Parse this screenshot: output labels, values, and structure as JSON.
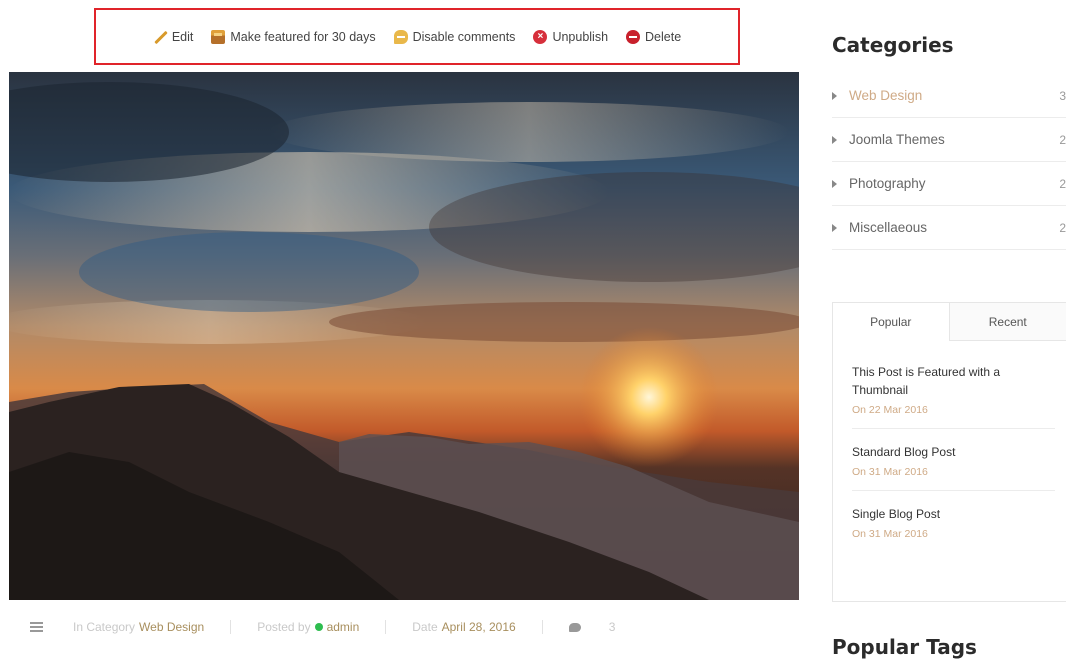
{
  "toolbar": {
    "edit": "Edit",
    "featured": "Make featured for 30 days",
    "disable_comments": "Disable comments",
    "unpublish": "Unpublish",
    "delete": "Delete"
  },
  "meta": {
    "category_prefix": "In Category",
    "category": "Web Design",
    "posted_by_prefix": "Posted by",
    "author": "admin",
    "date_prefix": "Date",
    "date": "April 28, 2016",
    "comments_count": "3"
  },
  "sidebar": {
    "categories_heading": "Categories",
    "categories": [
      {
        "label": "Web Design",
        "count": "3"
      },
      {
        "label": "Joomla Themes",
        "count": "2"
      },
      {
        "label": "Photography",
        "count": "2"
      },
      {
        "label": "Miscellaeous",
        "count": "2"
      }
    ],
    "tabs": [
      "Popular",
      "Recent"
    ],
    "posts": [
      {
        "title": "This Post is Featured with a Thumbnail",
        "date": "On 22 Mar 2016"
      },
      {
        "title": "Standard Blog Post",
        "date": "On 31 Mar 2016"
      },
      {
        "title": "Single Blog Post",
        "date": "On 31 Mar 2016"
      }
    ],
    "tags_heading": "Popular Tags"
  },
  "colors": {
    "toolbar_border": "#e0242a",
    "accent": "#cfaa86",
    "online": "#2ebd4f"
  }
}
